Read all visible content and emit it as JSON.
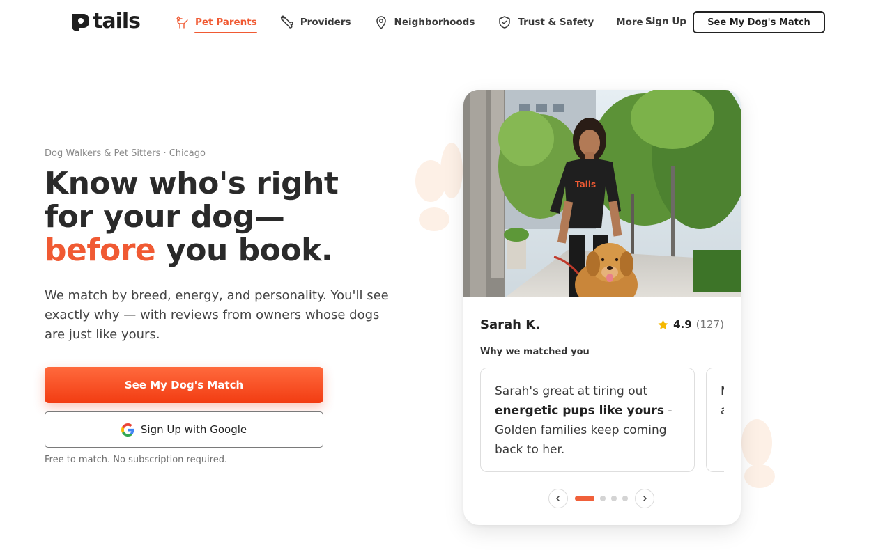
{
  "brand": {
    "name": "tails"
  },
  "nav": {
    "items": [
      {
        "label": "Pet Parents",
        "icon": "dog-icon",
        "active": true
      },
      {
        "label": "Providers",
        "icon": "bone-icon",
        "active": false
      },
      {
        "label": "Neighborhoods",
        "icon": "map-pin-icon",
        "active": false
      },
      {
        "label": "Trust & Safety",
        "icon": "shield-check-icon",
        "active": false
      }
    ],
    "more_label": "More",
    "signup_label": "Sign Up",
    "cta_label": "See My Dog's Match"
  },
  "hero": {
    "eyebrow": "Dog Walkers & Pet Sitters · Chicago",
    "headline_line1": "Know who's right",
    "headline_line2": "for your dog—",
    "headline_accent": "before",
    "headline_end": " you book.",
    "subtext": "We match by breed, energy, and personality. You'll see exactly why — with reviews from owners whose dogs are just like yours.",
    "primary_cta": "See My Dog's Match",
    "google_cta": "Sign Up with Google",
    "footnote": "Free to match. No subscription required."
  },
  "match_card": {
    "walker_name": "Sarah K.",
    "rating": "4.9",
    "review_count": "(127)",
    "why_label": "Why we matched you",
    "reasons": [
      {
        "pre": "Sarah's great at tiring out ",
        "bold": "energetic pups like yours",
        "post": " - Golden families keep coming back to her."
      },
      {
        "pre": "M",
        "bold": "",
        "post": "a"
      }
    ],
    "carousel": {
      "total": 4,
      "active": 1
    },
    "shirt_text": "Tails"
  },
  "colors": {
    "accent": "#f05a33",
    "text": "#2a2a2a",
    "muted": "#8a8a8a",
    "star": "#f5b800"
  }
}
